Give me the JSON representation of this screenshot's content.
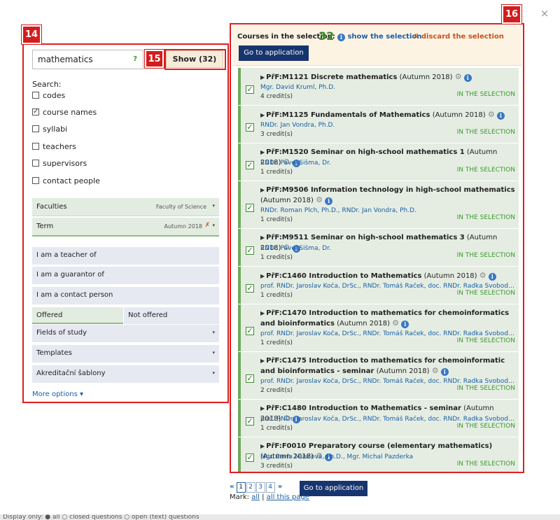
{
  "annotations": {
    "left_panel": "14",
    "show_button": "15",
    "right_panel": "16"
  },
  "search": {
    "query": "mathematics",
    "help": "?",
    "show_label": "Show (32)",
    "search_label": "Search:",
    "options": [
      {
        "label": "codes",
        "checked": false
      },
      {
        "label": "course names",
        "checked": true
      },
      {
        "label": "syllabi",
        "checked": false
      },
      {
        "label": "teachers",
        "checked": false
      },
      {
        "label": "supervisors",
        "checked": false
      },
      {
        "label": "contact people",
        "checked": false
      }
    ]
  },
  "filters": {
    "faculties_label": "Faculties",
    "faculties_value": "Faculty of Science",
    "term_label": "Term",
    "term_value": "Autumn 2018",
    "teacher": "I am a teacher of",
    "guarantor": "I am a guarantor of",
    "contact": "I am a contact person",
    "offered": "Offered",
    "not_offered": "Not offered",
    "fields": "Fields of study",
    "templates": "Templates",
    "akreditacni": "Akreditační šablony",
    "more": "More options ▾"
  },
  "selection": {
    "title": "Courses in the selection:",
    "count": "32",
    "show": "show the selection",
    "discard": "discard the selection",
    "go_label": "Go to application"
  },
  "courses": [
    {
      "code": "PřF:M1121 Discrete mathematics",
      "term": "(Autumn 2018)",
      "teachers": "Mgr. David Kruml, Ph.D.",
      "credits": "4 credit(s)",
      "status": "IN THE SELECTION"
    },
    {
      "code": "PřF:M1125 Fundamentals of Mathematics",
      "term": "(Autumn 2018)",
      "teachers": "RNDr. Jan Vondra, Ph.D.",
      "credits": "3 credit(s)",
      "status": "IN THE SELECTION"
    },
    {
      "code": "PřF:M1520 Seminar on high-school mathematics 1",
      "term": "(Autumn 2018)",
      "teachers": "RNDr. Pavel Šišma, Dr.",
      "credits": "1 credit(s)",
      "status": "IN THE SELECTION"
    },
    {
      "code": "PřF:M9506 Information technology in high-school mathematics",
      "term": "(Autumn 2018)",
      "teachers": "RNDr. Roman Plch, Ph.D., RNDr. Jan Vondra, Ph.D.",
      "credits": "1 credit(s)",
      "status": "IN THE SELECTION"
    },
    {
      "code": "PřF:M9511 Seminar on high-school mathematics 3",
      "term": "(Autumn 2018)",
      "teachers": "RNDr. Pavel Šišma, Dr.",
      "credits": "1 credit(s)",
      "status": "IN THE SELECTION"
    },
    {
      "code": "PřF:C1460 Introduction to Mathematics",
      "term": "(Autumn 2018)",
      "teachers": "prof. RNDr. Jaroslav Koča, DrSc., RNDr. Tomáš Raček, doc. RNDr. Radka Svobodová Vaře...",
      "credits": "1 credit(s)",
      "status": "IN THE SELECTION"
    },
    {
      "code": "PřF:C1470 Introduction to mathematics for chemoinformatics and bioinformatics",
      "term": "(Autumn 2018)",
      "teachers": "prof. RNDr. Jaroslav Koča, DrSc., RNDr. Tomáš Raček, doc. RNDr. Radka Svobodová Vaře...",
      "credits": "1 credit(s)",
      "status": "IN THE SELECTION"
    },
    {
      "code": "PřF:C1475 Introduction to mathematics for chemoinformatic and bioinformatics - seminar",
      "term": "(Autumn 2018)",
      "teachers": "prof. RNDr. Jaroslav Koča, DrSc., RNDr. Tomáš Raček, doc. RNDr. Radka Svobodová Vaře...",
      "credits": "2 credit(s)",
      "status": "IN THE SELECTION"
    },
    {
      "code": "PřF:C1480 Introduction to Mathematics - seminar",
      "term": "(Autumn 2018)",
      "teachers": "prof. RNDr. Jaroslav Koča, DrSc., RNDr. Tomáš Raček, doc. RNDr. Radka Svobodová Vaře...",
      "credits": "1 credit(s)",
      "status": "IN THE SELECTION"
    },
    {
      "code": "PřF:F0010 Preparatory course (elementary mathematics)",
      "term": "(Autumn 2018)",
      "teachers": "Mgr. Pavla Musilová, Ph.D., Mgr. Michal Pazderka",
      "credits": "3 credit(s)",
      "status": "IN THE SELECTION"
    }
  ],
  "pager": {
    "first": "«",
    "pages": [
      "1",
      "2",
      "3",
      "4"
    ],
    "last": "»",
    "go_label": "Go to application",
    "mark_label": "Mark:",
    "all": "all",
    "sep": "|",
    "all_page": "all this page"
  },
  "background": {
    "bottom_text": "Display only: ● all    ○ closed questions  ○ open (text) questions"
  },
  "colors": {
    "annotation": "#e01e1e",
    "navy": "#16346e",
    "selected_green": "#3a9a2a",
    "link": "#1a5ea5"
  },
  "icons": {
    "close": "×",
    "gear": "⚙",
    "info": "i",
    "triangle": "▶",
    "discard": "✗",
    "dropdown": "▾"
  }
}
